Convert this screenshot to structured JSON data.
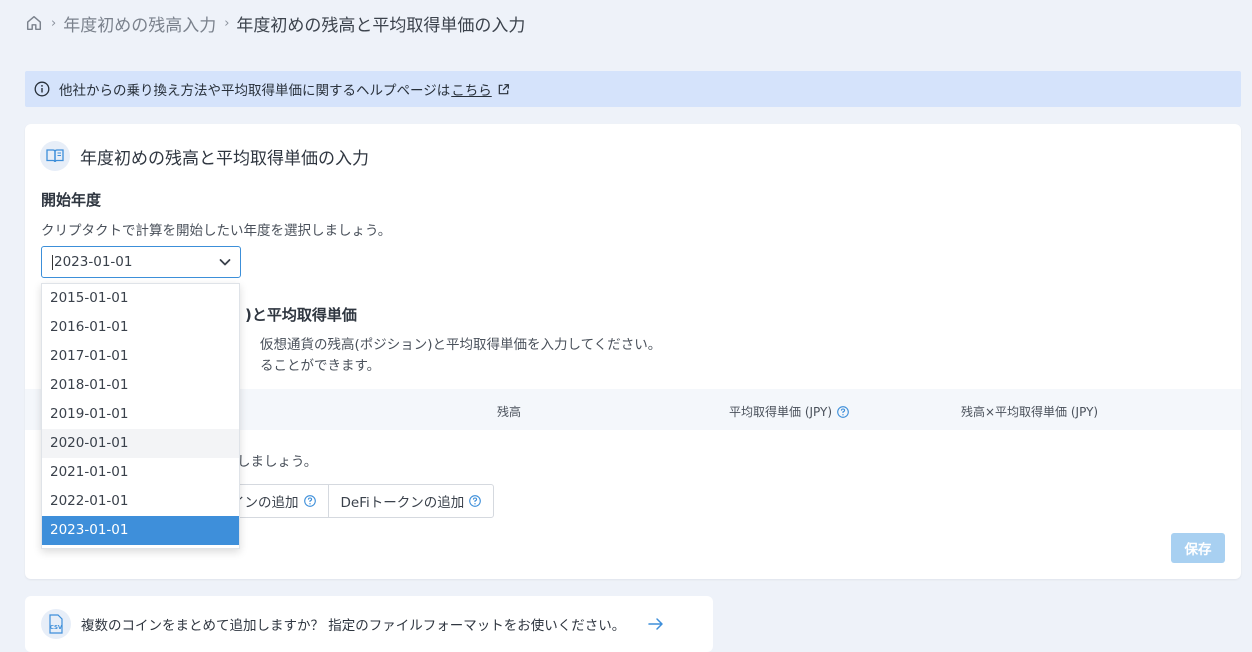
{
  "breadcrumb": {
    "link": "年度初めの残高入力",
    "current": "年度初めの残高と平均取得単価の入力",
    "separator": "›"
  },
  "alert": {
    "text": "他社からの乗り換え方法や平均取得単価に関するヘルプページは",
    "link": "こちら"
  },
  "card": {
    "title": "年度初めの残高と平均取得単価の入力",
    "start_year": {
      "label": "開始年度",
      "description": "クリプタクトで計算を開始したい年度を選択しましょう。",
      "selected": "2023-01-01"
    },
    "section2": {
      "title_visible": ")と平均取得単価",
      "desc1_visible": "仮想通貨の残高(ポジション)と平均取得単価を入力してください。",
      "desc2_visible": "ることができます。"
    },
    "table": {
      "col_balance": "残高",
      "col_avg_price": "平均取得単価 (JPY)",
      "col_total": "残高×平均取得単価 (JPY)"
    },
    "empty_text_visible": "しましょう。",
    "buttons": {
      "add_coin_visible": "インの追加",
      "add_defi": "DeFiトークンの追加"
    },
    "save": "保存"
  },
  "dropdown": {
    "options": [
      "2015-01-01",
      "2016-01-01",
      "2017-01-01",
      "2018-01-01",
      "2019-01-01",
      "2020-01-01",
      "2021-01-01",
      "2022-01-01",
      "2023-01-01"
    ],
    "hovered": "2020-01-01",
    "selected": "2023-01-01"
  },
  "csv_card": {
    "icon_text": "CSV",
    "text": "複数のコインをまとめて追加しますか？ 指定のファイルフォーマットをお使いください。"
  },
  "colors": {
    "accent": "#3e8fda",
    "alert_bg": "#d5e3fb",
    "save_disabled": "#a8d0f1"
  }
}
